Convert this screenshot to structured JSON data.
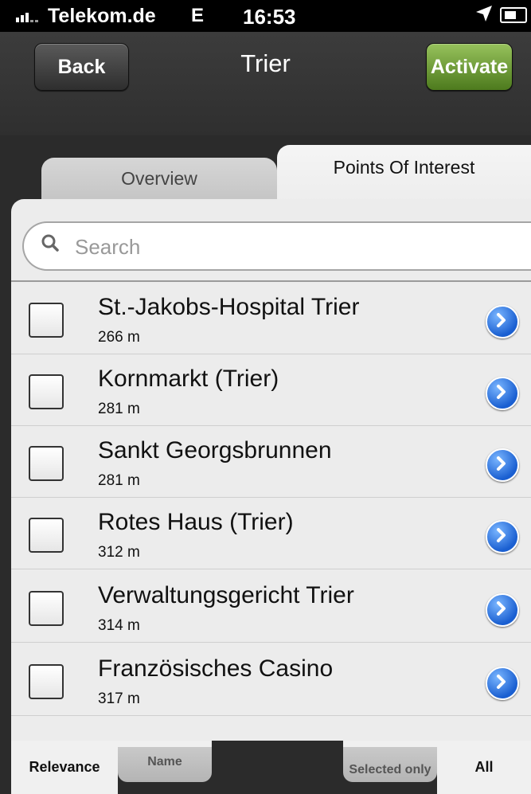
{
  "status_bar": {
    "carrier": "Telekom.de",
    "network": "E",
    "time": "16:53"
  },
  "nav": {
    "back_label": "Back",
    "title": "Trier",
    "activate_label": "Activate"
  },
  "tabs": [
    {
      "label": "Overview",
      "selected": false
    },
    {
      "label": "Points Of Interest",
      "selected": true
    }
  ],
  "search": {
    "placeholder": "Search",
    "value": ""
  },
  "items": [
    {
      "name": "St.-Jakobs-Hospital Trier",
      "distance": "266 m",
      "checked": false
    },
    {
      "name": "Kornmarkt (Trier)",
      "distance": "281 m",
      "checked": false
    },
    {
      "name": "Sankt Georgsbrunnen",
      "distance": "281 m",
      "checked": false
    },
    {
      "name": "Rotes Haus (Trier)",
      "distance": "312 m",
      "checked": false
    },
    {
      "name": "Verwaltungsgericht Trier",
      "distance": "314 m",
      "checked": false
    },
    {
      "name": "Französisches Casino",
      "distance": "317 m",
      "checked": false
    }
  ],
  "toolbar": {
    "relevance_label": "Relevance",
    "name_label": "Name",
    "selected_only_label": "Selected only",
    "all_label": "All"
  },
  "colors": {
    "accent_green": "#6a9a35",
    "disclosure_blue": "#1a5fd1",
    "background_dark": "#2b2b2b"
  }
}
